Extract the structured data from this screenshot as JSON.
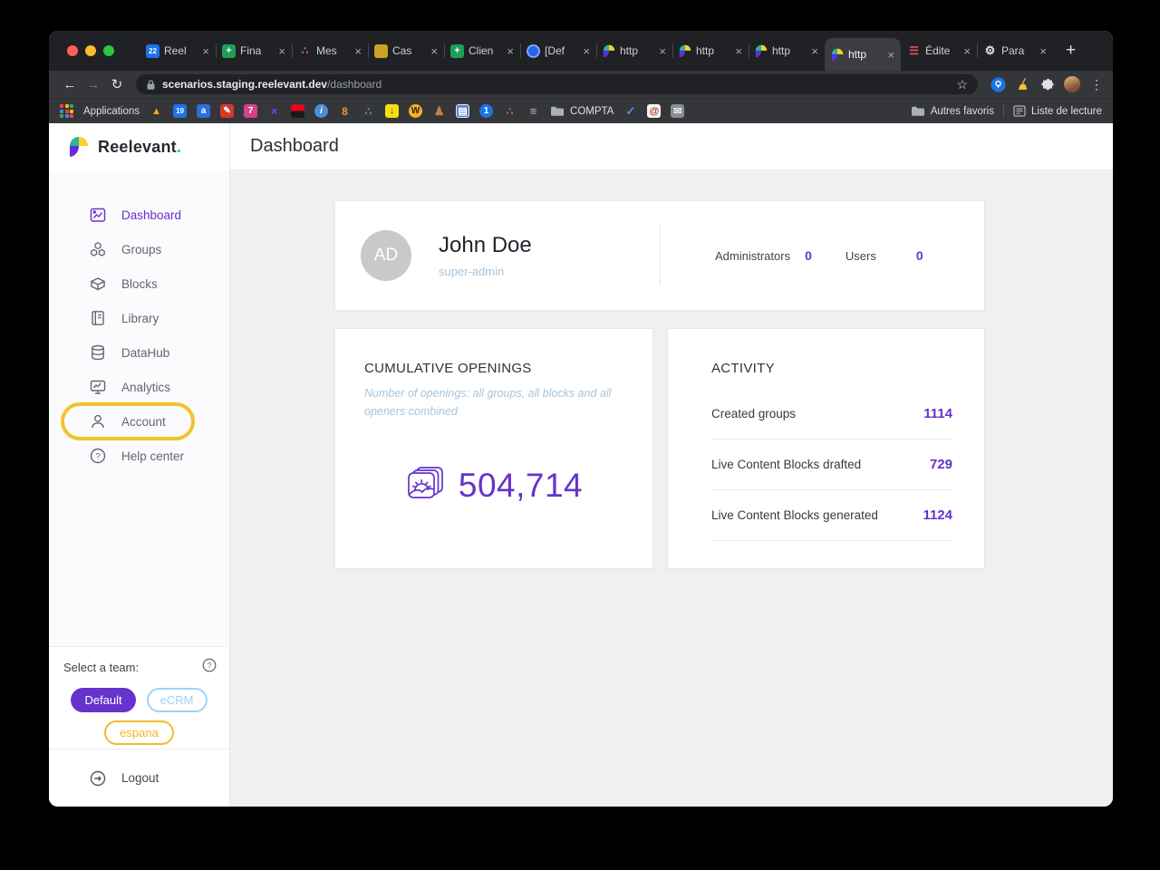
{
  "ui": {
    "close_glyph": "×",
    "new_tab_glyph": "+",
    "back_glyph": "←",
    "forward_glyph": "→",
    "reload_glyph": "↻",
    "star_glyph": "☆",
    "more_glyph": "⋮",
    "help_glyph": "?"
  },
  "tabs": [
    {
      "label": "Reel",
      "icon": "calendar",
      "glyph": "22"
    },
    {
      "label": "Fina",
      "icon": "sheets",
      "glyph": "+"
    },
    {
      "label": "Mes",
      "icon": "asana",
      "glyph": "∴"
    },
    {
      "label": "Cas",
      "icon": "folder-gold",
      "glyph": ""
    },
    {
      "label": "Clien",
      "icon": "sheets",
      "glyph": "+"
    },
    {
      "label": "[Def",
      "icon": "circle-blue",
      "glyph": ""
    },
    {
      "label": "http",
      "icon": "reelevant",
      "glyph": ""
    },
    {
      "label": "http",
      "icon": "reelevant",
      "glyph": ""
    },
    {
      "label": "http",
      "icon": "reelevant",
      "glyph": ""
    },
    {
      "label": "http",
      "icon": "reelevant",
      "glyph": "",
      "active": true
    },
    {
      "label": "Édite",
      "icon": "red-bars",
      "glyph": "☰"
    },
    {
      "label": "Para",
      "icon": "gear",
      "glyph": "⚙"
    }
  ],
  "toolbar": {
    "url_host": "scenarios.staging.reelevant.dev",
    "url_path": "/dashboard"
  },
  "bookmarks": {
    "apps_label": "Applications",
    "compta_label": "COMPTA",
    "autres_label": "Autres favoris",
    "lecture_label": "Liste de lecture",
    "favicons": [
      {
        "name": "drive",
        "glyph": "▲"
      },
      {
        "name": "calendar",
        "glyph": "19"
      },
      {
        "name": "docs",
        "glyph": "a"
      },
      {
        "name": "pen",
        "glyph": "✎"
      },
      {
        "name": "framer",
        "glyph": "7"
      },
      {
        "name": "purple-x",
        "glyph": "×"
      },
      {
        "name": "sg-flag",
        "glyph": ""
      },
      {
        "name": "info",
        "glyph": "i"
      },
      {
        "name": "key",
        "glyph": "8"
      },
      {
        "name": "molecule",
        "glyph": "∴"
      },
      {
        "name": "download",
        "glyph": "↓"
      },
      {
        "name": "wordreference",
        "glyph": "W"
      },
      {
        "name": "person",
        "glyph": "♟"
      },
      {
        "name": "card",
        "glyph": "▤"
      },
      {
        "name": "onepassword",
        "glyph": "1"
      },
      {
        "name": "asana",
        "glyph": "∴"
      },
      {
        "name": "layers",
        "glyph": "≡"
      },
      {
        "name": "check",
        "glyph": "✓"
      },
      {
        "name": "at",
        "glyph": "@"
      },
      {
        "name": "mail",
        "glyph": "✉"
      }
    ]
  },
  "sidebar": {
    "brand": "Reelevant",
    "brand_dot": ".",
    "items": [
      {
        "label": "Dashboard",
        "active": true
      },
      {
        "label": "Groups"
      },
      {
        "label": "Blocks"
      },
      {
        "label": "Library"
      },
      {
        "label": "DataHub"
      },
      {
        "label": "Analytics"
      },
      {
        "label": "Account",
        "highlighted": true
      },
      {
        "label": "Help center"
      }
    ],
    "team_label": "Select a team:",
    "chips": [
      {
        "label": "Default",
        "variant": "filled-purple"
      },
      {
        "label": "eCRM",
        "variant": "outline-blue"
      },
      {
        "label": "espana",
        "variant": "outline-yellow"
      }
    ],
    "logout_label": "Logout"
  },
  "header": {
    "title": "Dashboard"
  },
  "profile": {
    "initials": "AD",
    "name": "John Doe",
    "role": "super-admin",
    "stats": [
      {
        "label": "Administrators",
        "value": "0"
      },
      {
        "label": "Users",
        "value": "0"
      }
    ]
  },
  "openings": {
    "title": "CUMULATIVE OPENINGS",
    "subtitle": "Number of openings: all groups, all blocks and all openers combined",
    "value": "504,714"
  },
  "activity": {
    "title": "ACTIVITY",
    "rows": [
      {
        "label": "Created groups",
        "value": "1114"
      },
      {
        "label": "Live Content Blocks drafted",
        "value": "729"
      },
      {
        "label": "Live Content Blocks generated",
        "value": "1124"
      }
    ]
  },
  "annotation": {
    "highlighted_item": "Account",
    "color": "#f4c32a"
  },
  "colors": {
    "accent_purple": "#6633cc",
    "highlight_yellow": "#f4c32a",
    "chip_blue": "#9fd3f6",
    "chip_yellow": "#f2bd2a",
    "subtitle_blue": "#a9c3da",
    "brand_teal": "#2bb596",
    "chrome_frame": "#1f2124",
    "chrome_toolbar": "#35363a"
  }
}
